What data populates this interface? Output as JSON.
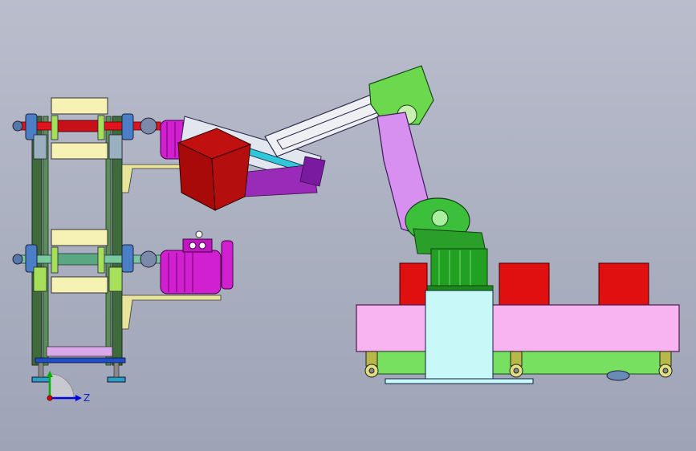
{
  "viewport": {
    "background_top": "#b9bdcc",
    "background_bottom": "#9ea4b6"
  },
  "triad": {
    "z_label": "Z",
    "x_color": "#e00000",
    "y_color": "#00b000",
    "z_color": "#0000e0"
  },
  "colors": {
    "frame_green": "#3f6b3c",
    "motor_magenta": "#d020d0",
    "box_red": "#b00000",
    "robot_green": "#39c039",
    "robot_arm_violet": "#d890f0",
    "rail_pink": "#f8b4f0",
    "base_green": "#78e060",
    "pillar_cyan": "#c8f8f8",
    "block_red": "#e01010",
    "pad_yellow": "#f0f0b0"
  }
}
